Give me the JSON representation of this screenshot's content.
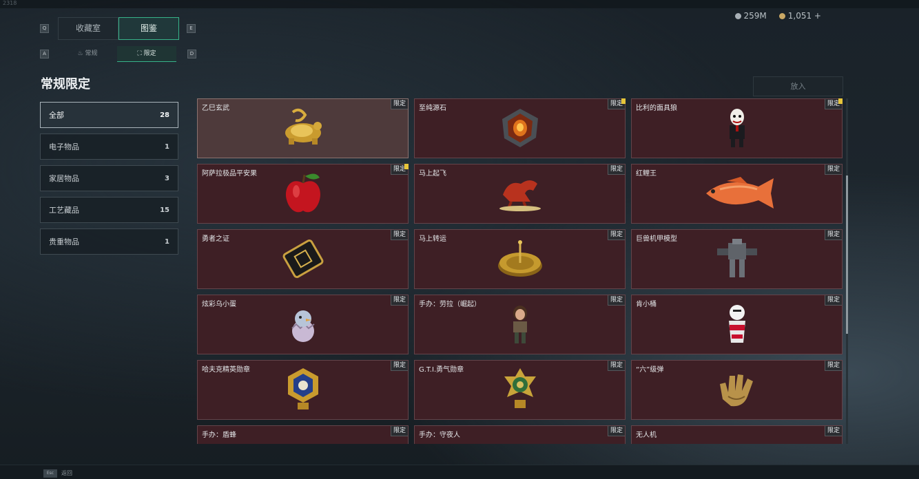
{
  "header": {
    "corner_text": "2318",
    "currency": [
      {
        "icon": "silver-coin-icon",
        "value": "259M"
      },
      {
        "icon": "gold-coin-icon",
        "value": "1,051 +"
      }
    ],
    "key_hints": {
      "q": "Q",
      "e": "E",
      "a": "A",
      "d": "D"
    }
  },
  "tabs": [
    {
      "label": "收藏室",
      "active": false
    },
    {
      "label": "图鉴",
      "active": true
    }
  ],
  "subtabs": [
    {
      "label": "常规",
      "icon": "flame-icon",
      "active": false
    },
    {
      "label": "限定",
      "icon": "limited-icon",
      "active": true
    }
  ],
  "section_title": "常规限定",
  "categories": [
    {
      "label": "全部",
      "count": "28",
      "active": true
    },
    {
      "label": "电子物品",
      "count": "1"
    },
    {
      "label": "家居物品",
      "count": "3"
    },
    {
      "label": "工艺藏品",
      "count": "15"
    },
    {
      "label": "贵重物品",
      "count": "1"
    }
  ],
  "put_in_button": "放入",
  "items": [
    {
      "name": "乙巳玄武",
      "badge": "限定",
      "selected": true,
      "alert": false,
      "art": "golden-tortoise-icon"
    },
    {
      "name": "至纯源石",
      "badge": "限定",
      "alert": true,
      "art": "crystal-stone-icon"
    },
    {
      "name": "比利的面具狼",
      "badge": "限定",
      "alert": true,
      "art": "puppet-doll-icon"
    },
    {
      "name": "阿萨拉极品平安果",
      "badge": "限定",
      "alert": true,
      "art": "red-apple-icon"
    },
    {
      "name": "马上起飞",
      "badge": "限定",
      "alert": false,
      "art": "flying-horse-icon"
    },
    {
      "name": "红鲤王",
      "badge": "限定",
      "alert": false,
      "art": "red-carp-icon"
    },
    {
      "name": "勇者之证",
      "badge": "限定",
      "alert": false,
      "art": "hero-card-icon"
    },
    {
      "name": "马上转运",
      "badge": "限定",
      "alert": false,
      "art": "golden-compass-icon"
    },
    {
      "name": "巨兽机甲模型",
      "badge": "限定",
      "alert": false,
      "art": "mech-model-icon"
    },
    {
      "name": "炫彩乌小蛋",
      "badge": "限定",
      "alert": false,
      "art": "bird-egg-icon"
    },
    {
      "name": "手办：劳拉（崛起）",
      "badge": "限定",
      "alert": false,
      "art": "lara-figure-icon"
    },
    {
      "name": "肯小桶",
      "badge": "限定",
      "alert": false,
      "art": "bucket-figure-icon"
    },
    {
      "name": "哈夫克精英勋章",
      "badge": "限定",
      "alert": false,
      "art": "elite-medal-icon"
    },
    {
      "name": "G.T.I.勇气勋章",
      "badge": "限定",
      "alert": false,
      "art": "courage-medal-icon"
    },
    {
      "name": "“六”级弹",
      "badge": "限定",
      "alert": false,
      "art": "golden-hand-icon"
    },
    {
      "name": "手办：盾蜂",
      "badge": "限定",
      "alert": false,
      "art": "figure-icon"
    },
    {
      "name": "手办：守夜人",
      "badge": "限定",
      "alert": false,
      "art": "figure-icon"
    },
    {
      "name": "无人机",
      "badge": "限定",
      "alert": false,
      "art": "drone-icon"
    }
  ],
  "scroll_position": 0.41,
  "footer": {
    "key": "Esc",
    "label": "返回"
  }
}
